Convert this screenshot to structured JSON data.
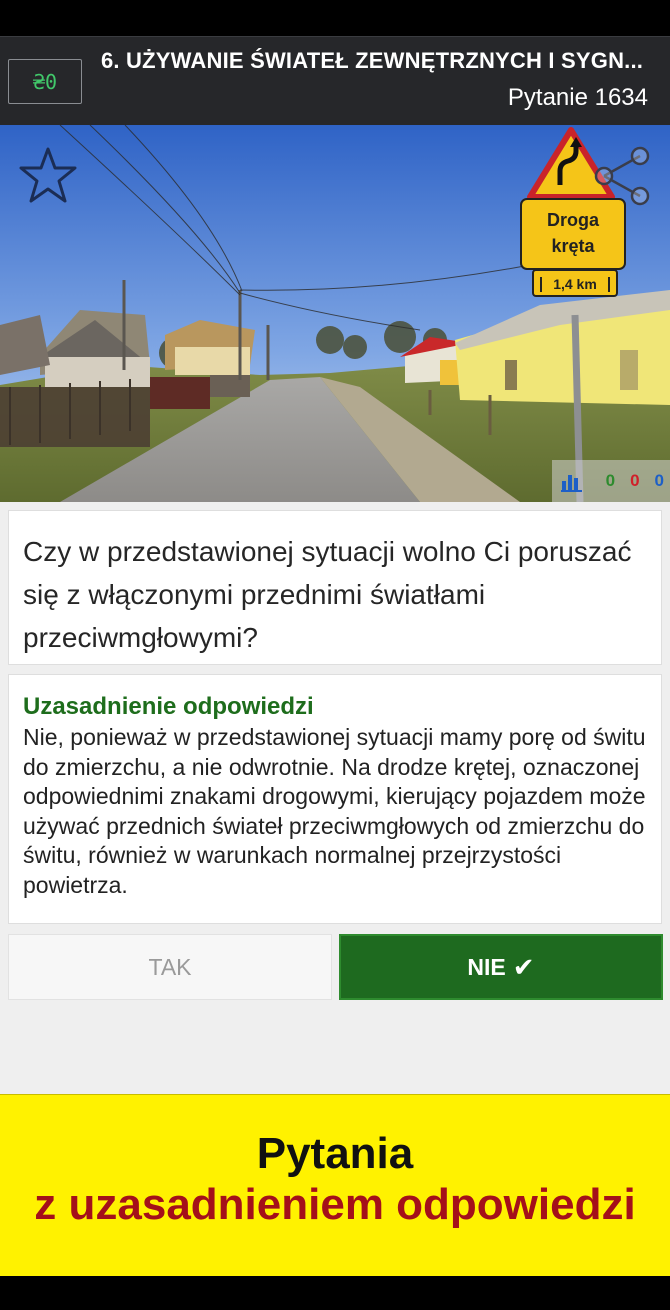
{
  "header": {
    "badge_glyph": "₴0",
    "category_title": "6. UŻYWANIE ŚWIATEŁ ZEWNĘTRZNYCH I SYGN...",
    "question_number": "Pytanie 1634"
  },
  "scene": {
    "sign_text_line1": "Droga",
    "sign_text_line2": "kręta",
    "plate_text": "1,4 km",
    "stats": {
      "correct": "0",
      "wrong": "0",
      "unanswered": "0"
    }
  },
  "question": {
    "text": "Czy w przedstawionej sytuacji wolno Ci poruszać się z włączonymi przednimi światłami przeciwmgłowymi?"
  },
  "explanation": {
    "title": "Uzasadnienie odpowiedzi",
    "text": "Nie, ponieważ w przedstawionej sytuacji mamy porę od świtu do zmierzchu, a nie odwrotnie. Na drodze krętej, oznaczonej odpowiednimi znakami drogowymi, kierujący pojazdem może używać przednich świateł przeciwmgłowych od zmierzchu do świtu, również w warunkach normalnej przejrzystości powietrza."
  },
  "answers": {
    "yes_label": "TAK",
    "no_label": "NIE",
    "check_glyph": "✔"
  },
  "promo": {
    "line1": "Pytania",
    "line2": "z uzasadnieniem odpowiedzi"
  },
  "colors": {
    "accent_green": "#1e6a1f",
    "explanation_title": "#1e6d1c",
    "promo_background": "#fff200",
    "promo_red": "#a4101a"
  },
  "icons": [
    "star-icon",
    "share-icon",
    "chart-icon",
    "check-icon"
  ]
}
